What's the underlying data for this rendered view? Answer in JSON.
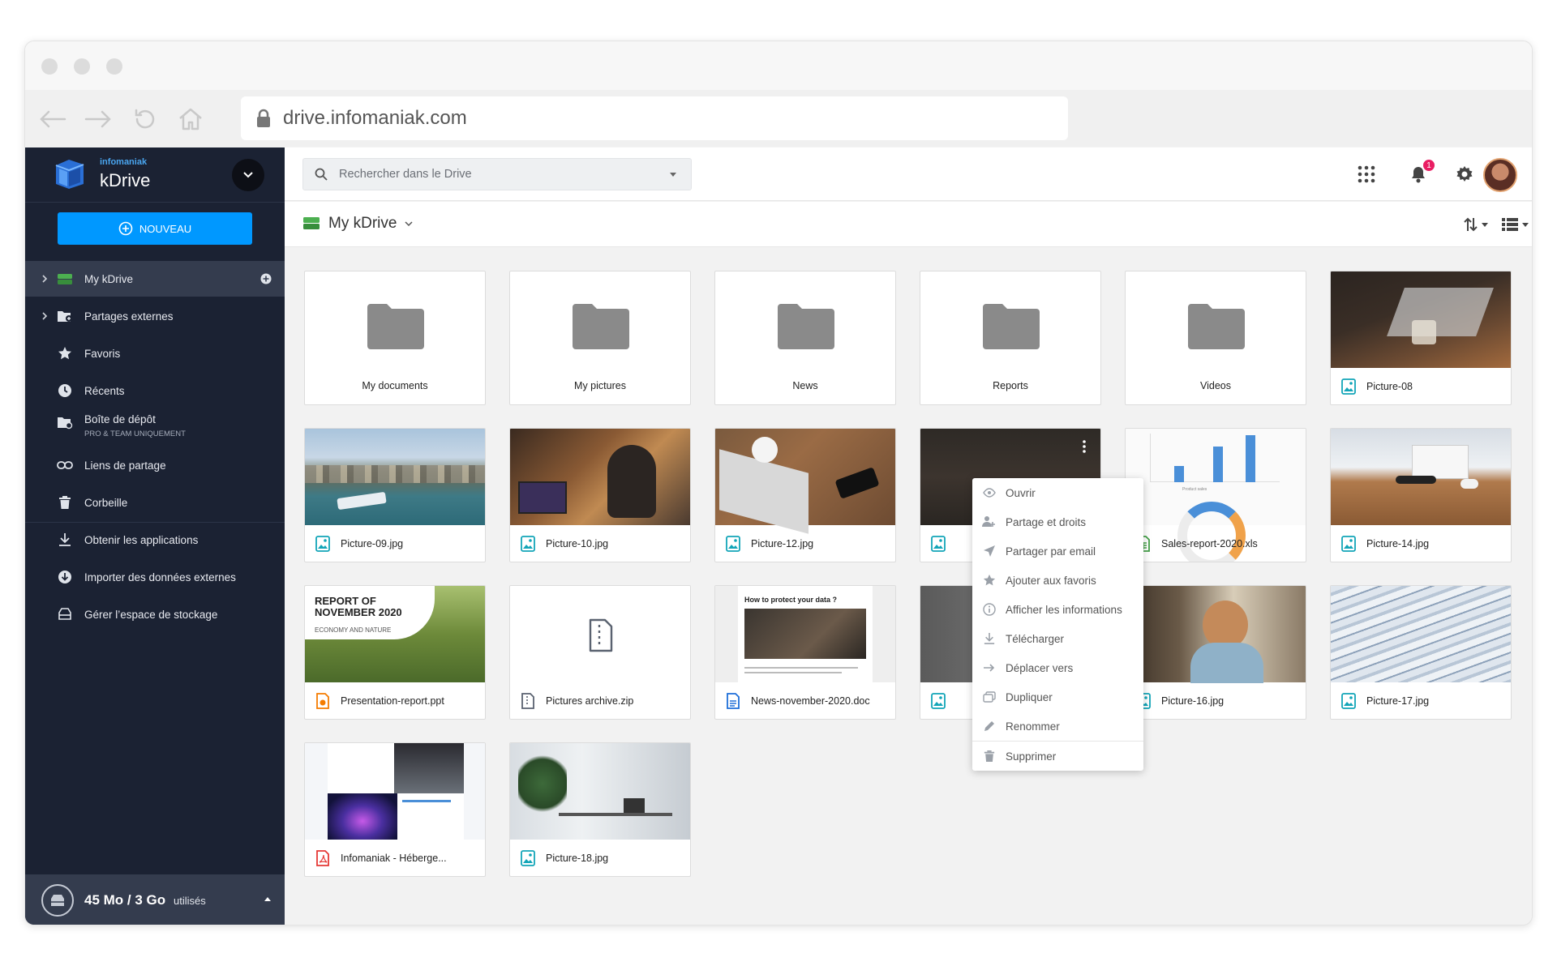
{
  "browser": {
    "url": "drive.infomaniak.com"
  },
  "brand": {
    "company": "infomaniak",
    "product": "kDrive"
  },
  "sidebar": {
    "new_button": "NOUVEAU",
    "items": [
      {
        "label": "My kDrive",
        "icon": "drive-icon"
      },
      {
        "label": "Partages externes",
        "icon": "external-share-icon"
      },
      {
        "label": "Favoris",
        "icon": "star-icon"
      },
      {
        "label": "Récents",
        "icon": "clock-icon"
      },
      {
        "label": "Boîte de dépôt",
        "sub": "PRO & TEAM UNIQUEMENT",
        "icon": "dropbox-folder-icon"
      },
      {
        "label": "Liens de partage",
        "icon": "link-icon"
      },
      {
        "label": "Corbeille",
        "icon": "trash-icon"
      },
      {
        "label": "Obtenir les applications",
        "icon": "download-icon"
      },
      {
        "label": "Importer des données externes",
        "icon": "import-icon"
      },
      {
        "label": "Gérer l’espace de stockage",
        "icon": "storage-icon"
      }
    ],
    "storage": {
      "amount": "45 Mo / 3 Go",
      "label": "utilisés"
    }
  },
  "topbar": {
    "search_placeholder": "Rechercher dans le Drive",
    "notification_count": "1"
  },
  "breadcrumb": {
    "title": "My kDrive"
  },
  "files": [
    {
      "name": "My documents",
      "kind": "folder"
    },
    {
      "name": "My pictures",
      "kind": "folder"
    },
    {
      "name": "News",
      "kind": "folder"
    },
    {
      "name": "Reports",
      "kind": "folder"
    },
    {
      "name": "Videos",
      "kind": "folder"
    },
    {
      "name": "Picture-08",
      "kind": "image"
    },
    {
      "name": "Picture-09.jpg",
      "kind": "image"
    },
    {
      "name": "Picture-10.jpg",
      "kind": "image"
    },
    {
      "name": "Picture-12.jpg",
      "kind": "image"
    },
    {
      "name": "",
      "kind": "image"
    },
    {
      "name": "Sales-report-2020.xls",
      "kind": "sheet"
    },
    {
      "name": "Picture-14.jpg",
      "kind": "image"
    },
    {
      "name": "Presentation-report.ppt",
      "kind": "slides"
    },
    {
      "name": "Pictures archive.zip",
      "kind": "zip"
    },
    {
      "name": "News-november-2020.doc",
      "kind": "doc"
    },
    {
      "name": "",
      "kind": "image"
    },
    {
      "name": "Picture-16.jpg",
      "kind": "image"
    },
    {
      "name": "Picture-17.jpg",
      "kind": "image"
    },
    {
      "name": "Infomaniak - Héberge...",
      "kind": "pdf"
    },
    {
      "name": "Picture-18.jpg",
      "kind": "image"
    }
  ],
  "thumb_text": {
    "report_title": "REPORT OF NOVEMBER 2020",
    "report_sub": "ECONOMY AND NATURE",
    "doc_title": "How to protect your data ?",
    "chart_caption": "Product sales"
  },
  "context_menu": [
    {
      "label": "Ouvrir",
      "icon": "eye-icon"
    },
    {
      "label": "Partage et droits",
      "icon": "share-rights-icon"
    },
    {
      "label": "Partager par email",
      "icon": "send-icon"
    },
    {
      "label": "Ajouter aux favoris",
      "icon": "star-icon"
    },
    {
      "label": "Afficher les informations",
      "icon": "info-icon"
    },
    {
      "label": "Télécharger",
      "icon": "download-icon"
    },
    {
      "label": "Déplacer vers",
      "icon": "arrow-right-icon"
    },
    {
      "label": "Dupliquer",
      "icon": "duplicate-icon"
    },
    {
      "label": "Renommer",
      "icon": "pencil-icon"
    },
    {
      "label": "Supprimer",
      "icon": "trash-icon"
    }
  ],
  "colors": {
    "accent": "#0098ff",
    "sidebar_bg": "#1b2233",
    "drive_green": "#4caf50",
    "badge": "#e91e63"
  }
}
